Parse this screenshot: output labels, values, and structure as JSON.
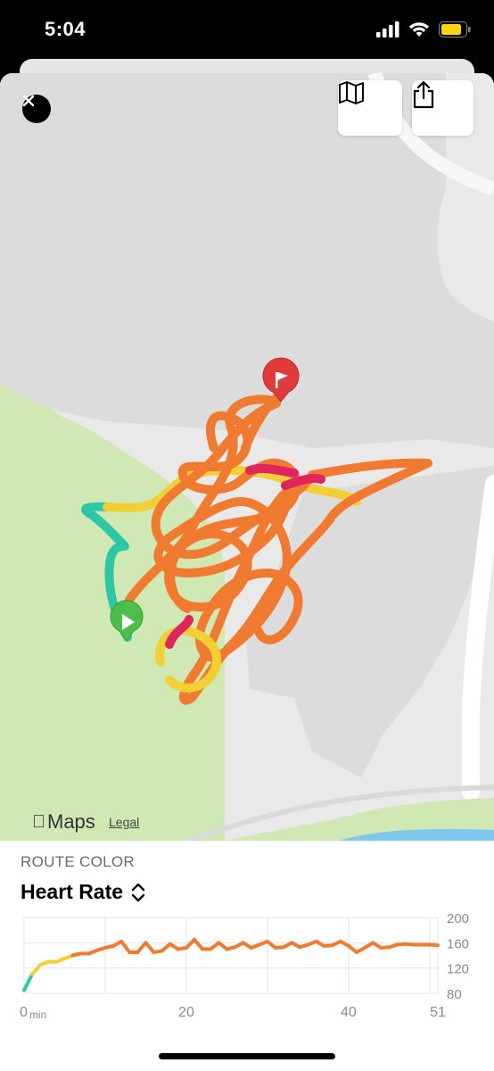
{
  "status_bar": {
    "time": "5:04",
    "battery_color": "#ffd60a"
  },
  "map": {
    "close_icon": "close-icon",
    "map_button_icon": "map-icon",
    "share_button_icon": "share-icon",
    "start_marker_icon": "play-icon",
    "end_marker_icon": "flag-icon",
    "logo_text": "Maps",
    "legal_text": "Legal",
    "colors": {
      "park": "#cfe8b4",
      "land": "#e9e9e9",
      "water": "#7ec8ee",
      "start": "#4cbf4a",
      "end": "#e23b3b"
    }
  },
  "panel": {
    "route_color_label": "ROUTE COLOR",
    "metric_label": "Heart Rate",
    "metric_icon": "chevron-up-down-icon"
  },
  "chart_data": {
    "type": "line",
    "title": "",
    "xlabel": "",
    "ylabel": "",
    "x_ticks": [
      "0",
      "20",
      "40",
      "51"
    ],
    "x_unit": "min",
    "y_ticks": [
      "200",
      "160",
      "120",
      "80"
    ],
    "xlim": [
      0,
      51
    ],
    "ylim": [
      80,
      200
    ],
    "grid": true,
    "series": [
      {
        "x": [
          0,
          1,
          2,
          3,
          4,
          5,
          6,
          7,
          8,
          9,
          10,
          11,
          12,
          13,
          14,
          15,
          16,
          17,
          18,
          19,
          20,
          21,
          22,
          23,
          24,
          25,
          26,
          27,
          28,
          29,
          30,
          31,
          32,
          33,
          34,
          35,
          36,
          37,
          38,
          39,
          40,
          41,
          42,
          43,
          44,
          45,
          46,
          47,
          48,
          49,
          50,
          51
        ],
        "values": [
          85,
          110,
          125,
          130,
          130,
          135,
          140,
          143,
          143,
          148,
          152,
          155,
          162,
          145,
          145,
          160,
          145,
          147,
          158,
          150,
          152,
          165,
          150,
          150,
          160,
          150,
          153,
          160,
          152,
          157,
          162,
          152,
          153,
          160,
          153,
          157,
          162,
          155,
          156,
          162,
          155,
          145,
          152,
          160,
          152,
          153,
          157,
          158,
          157,
          157,
          157,
          156
        ]
      }
    ],
    "color_scale": {
      "low": "#2ec7a5",
      "mid": "#f2cf33",
      "high": "#f07a30",
      "peak": "#e0245e"
    }
  }
}
